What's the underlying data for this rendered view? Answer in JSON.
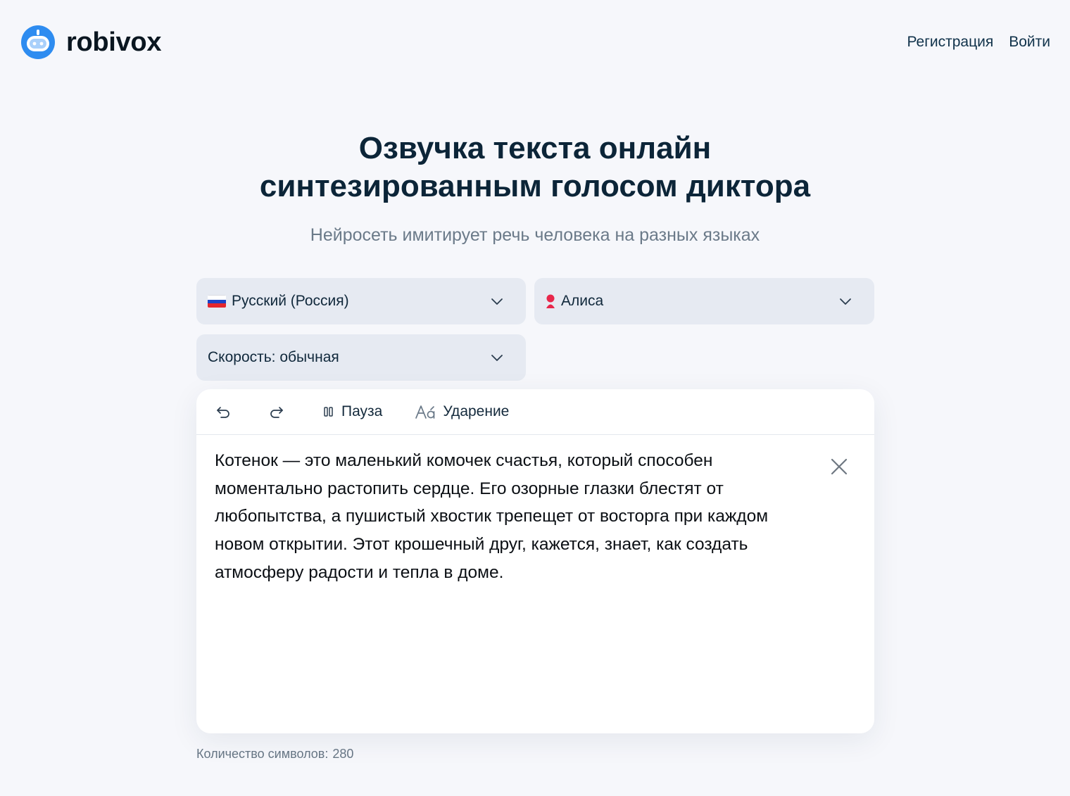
{
  "brand": {
    "name": "robivox",
    "accent": "#2e8cf0"
  },
  "nav": {
    "register": "Регистрация",
    "login": "Войти"
  },
  "hero": {
    "title_line1": "Озвучка текста онлайн",
    "title_line2": "синтезированным голосом диктора",
    "subtitle": "Нейросеть имитирует речь человека на разных языках"
  },
  "selects": {
    "language": {
      "value": "Русский (Россия)",
      "icon": "russia-flag-icon"
    },
    "voice": {
      "value": "Алиса",
      "icon": "female-voice-icon",
      "icon_color": "#e8274b"
    },
    "speed": {
      "value": "Скорость: обычная"
    }
  },
  "toolbar": {
    "undo_icon": "undo-icon",
    "redo_icon": "redo-icon",
    "pause_label": "Пауза",
    "stress_label": "Ударение"
  },
  "editor": {
    "text": "Котенок — это маленький комочек счастья, который способен моментально растопить сердце. Его озорные глазки блестят от любопытства, а пушистый хвостик трепещет от восторга при каждом новом открытии. Этот крошечный друг, кажется, знает, как создать атмосферу радости и тепла в доме."
  },
  "counter": {
    "label": "Количество символов:",
    "value": "280"
  }
}
